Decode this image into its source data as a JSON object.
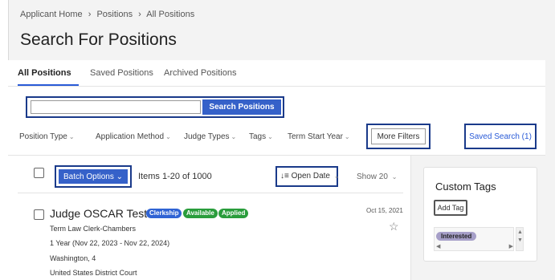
{
  "breadcrumb": {
    "items": [
      "Applicant Home",
      "Positions",
      "All Positions"
    ],
    "separator": "›"
  },
  "page": {
    "title": "Search For Positions"
  },
  "tabs": [
    "All Positions",
    "Saved Positions",
    "Archived Positions"
  ],
  "search": {
    "value": "",
    "placeholder": "",
    "button": "Search Positions"
  },
  "filters": {
    "items": [
      "Position Type",
      "Application Method",
      "Judge Types",
      "Tags",
      "Term Start Year"
    ],
    "chevron": "⌄",
    "more_filters": "More Filters",
    "saved_search": "Saved Search (1)"
  },
  "results": {
    "batch_options": "Batch Options",
    "batch_chevron": "⌄",
    "items_count": "Items 1-20 of 1000",
    "sort_icon": "↓≡",
    "sort_label": "Open Date",
    "show": "Show 20",
    "show_chevron": "⌄"
  },
  "position": {
    "title": "Judge OSCAR Test",
    "badges": [
      "Clerkship",
      "Available",
      "Applied"
    ],
    "date": "Oct 15, 2021",
    "role": "Term Law Clerk-Chambers",
    "term": "1 Year (Nov 22, 2023 - Nov 22, 2024)",
    "location": "Washington, 4",
    "court": "United States District Court",
    "star_icon": "☆"
  },
  "custom_tags": {
    "title": "Custom Tags",
    "add_tag": "Add Tag",
    "tags": [
      "Interested"
    ]
  },
  "colors": {
    "primary": "#3561c9",
    "outline": "#1a3a8a",
    "link": "#2a5bd7",
    "success": "#2a9d3c",
    "tag": "#a69fc8"
  }
}
